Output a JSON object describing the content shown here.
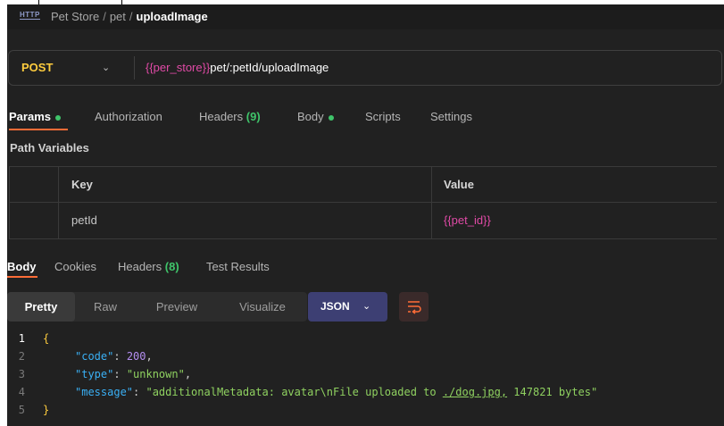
{
  "breadcrumb": {
    "icon": "http-icon",
    "icon_text": "HTTP",
    "items": [
      "Pet Store",
      "pet"
    ],
    "current": "uploadImage"
  },
  "request": {
    "method": "POST",
    "url_variable": "{{per_store}}",
    "url_path": "pet/:petId/uploadImage"
  },
  "request_tabs": [
    {
      "label": "Params",
      "active": true,
      "dot": true
    },
    {
      "label": "Authorization"
    },
    {
      "label": "Headers",
      "count": "(9)"
    },
    {
      "label": "Body",
      "dot": true
    },
    {
      "label": "Scripts"
    },
    {
      "label": "Settings"
    }
  ],
  "path_variables": {
    "title": "Path Variables",
    "columns": [
      "Key",
      "Value"
    ],
    "rows": [
      {
        "key": "petId",
        "value": "{{pet_id}}"
      }
    ]
  },
  "response_tabs": [
    {
      "label": "Body",
      "active": true
    },
    {
      "label": "Cookies"
    },
    {
      "label": "Headers",
      "count": "(8)"
    },
    {
      "label": "Test Results"
    }
  ],
  "response_view": {
    "modes": [
      "Pretty",
      "Raw",
      "Preview",
      "Visualize"
    ],
    "active_mode": "Pretty",
    "format": "JSON"
  },
  "response_body": {
    "line_numbers": [
      "1",
      "2",
      "3",
      "4",
      "5"
    ],
    "open_brace": "{",
    "close_brace": "}",
    "fields": [
      {
        "key": "\"code\"",
        "value": "200",
        "kind": "number",
        "trail": ","
      },
      {
        "key": "\"type\"",
        "value": "\"unknown\"",
        "kind": "string",
        "trail": ","
      },
      {
        "key": "\"message\"",
        "value_pre": "\"additionalMetadata: avatar\\nFile uploaded to ",
        "value_link": "./dog.jpg,",
        "value_post": " 147821 bytes\"",
        "kind": "string",
        "trail": ""
      }
    ]
  },
  "colors": {
    "background": "#212121",
    "method": "#fecc3e",
    "variable": "#e04aa6",
    "active_indicator": "#ff6c37",
    "dot": "#3fc46a",
    "json_key": "#3ab0f5",
    "json_string": "#8fd160",
    "json_number": "#b48ef0"
  }
}
